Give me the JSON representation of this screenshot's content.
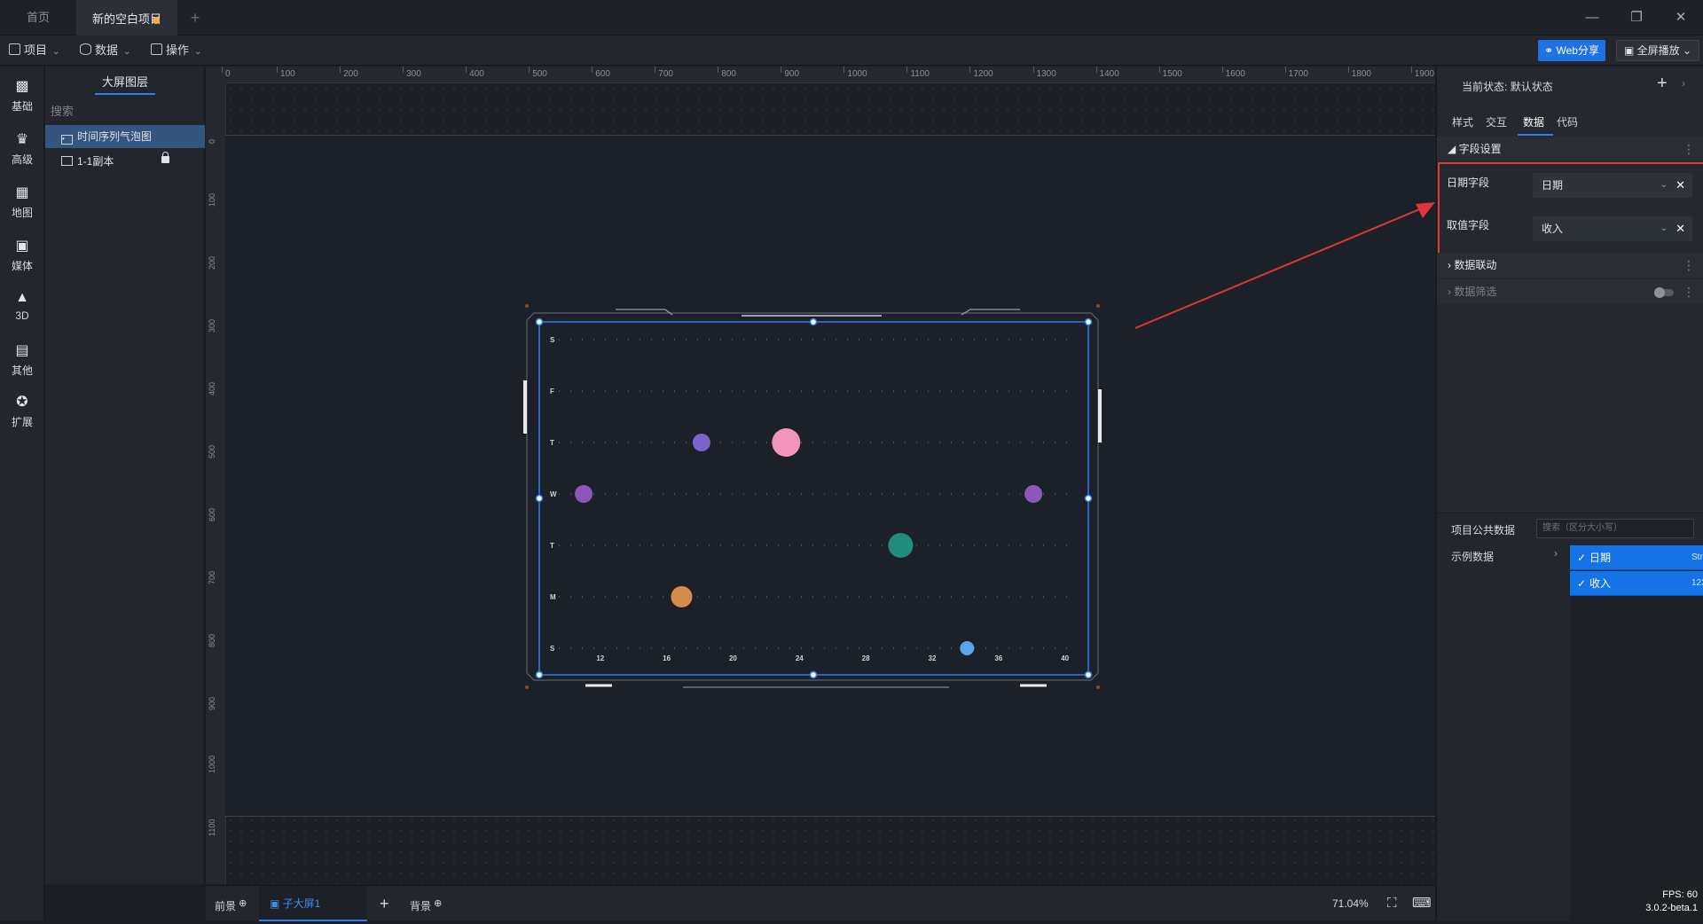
{
  "tabs": {
    "home": "首页",
    "project": "新的空白项目"
  },
  "menu": {
    "project": "项目",
    "data": "数据",
    "operate": "操作",
    "web_share": "Web分享",
    "fullscreen": "全屏播放"
  },
  "iconbar": [
    "基础",
    "高级",
    "地图",
    "媒体",
    "3D",
    "其他",
    "扩展"
  ],
  "layers": {
    "title": "大屏图层",
    "search": "搜索",
    "items": [
      {
        "label": "时间序列气泡图"
      },
      {
        "label": "1-1副本"
      }
    ]
  },
  "rulers": {
    "top": [
      "0",
      "100",
      "200",
      "300",
      "400",
      "500",
      "600",
      "700",
      "800",
      "900",
      "1000",
      "1100",
      "1200",
      "1300",
      "1400",
      "1500",
      "1600",
      "1700",
      "1800",
      "1900"
    ],
    "left": [
      "0",
      "100",
      "200",
      "300",
      "400",
      "500",
      "600",
      "700",
      "800",
      "900",
      "1000",
      "1100"
    ]
  },
  "chart_data": {
    "type": "scatter",
    "y_categories": [
      "S",
      "F",
      "T",
      "W",
      "T",
      "M",
      "S"
    ],
    "x_ticks": [
      12,
      16,
      20,
      24,
      28,
      32,
      36,
      40
    ],
    "xlim": [
      9.5,
      40.5
    ],
    "points": [
      {
        "x": 18.1,
        "y": "T",
        "row": 2,
        "size": 10,
        "color": "#7c64c8"
      },
      {
        "x": 23.2,
        "y": "T",
        "row": 2,
        "size": 16,
        "color": "#f394bb"
      },
      {
        "x": 11.0,
        "y": "W",
        "row": 3,
        "size": 10,
        "color": "#8b57b8"
      },
      {
        "x": 38.1,
        "y": "W",
        "row": 3,
        "size": 10,
        "color": "#8b57b8"
      },
      {
        "x": 30.1,
        "y": "T",
        "row": 4,
        "size": 14,
        "color": "#218e7d"
      },
      {
        "x": 16.9,
        "y": "M",
        "row": 5,
        "size": 12,
        "color": "#d48e4a"
      },
      {
        "x": 34.1,
        "y": "S",
        "row": 6,
        "size": 8,
        "color": "#5aa4e8"
      }
    ]
  },
  "bottombar": {
    "foreground": "前景",
    "sub_screen": "子大屏1",
    "background": "背景",
    "zoom": "71.04%"
  },
  "rightpanel": {
    "state_label": "当前状态:",
    "state_value": "默认状态",
    "tabs": [
      "样式",
      "交互",
      "数据",
      "代码"
    ],
    "field_settings": "字段设置",
    "date_field_label": "日期字段",
    "date_field_value": "日期",
    "value_field_label": "取值字段",
    "value_field_value": "收入",
    "data_linkage": "数据联动",
    "data_filter": "数据筛选",
    "common_data_title": "项目公共数据",
    "common_data_search": "搜索（区分大小写）",
    "example_data": "示例数据",
    "columns": [
      {
        "name": "日期",
        "type": "Str"
      },
      {
        "name": "收入",
        "type": "123"
      }
    ]
  },
  "status": {
    "fps": "FPS: 60",
    "version": "3.0.2-beta.1"
  }
}
